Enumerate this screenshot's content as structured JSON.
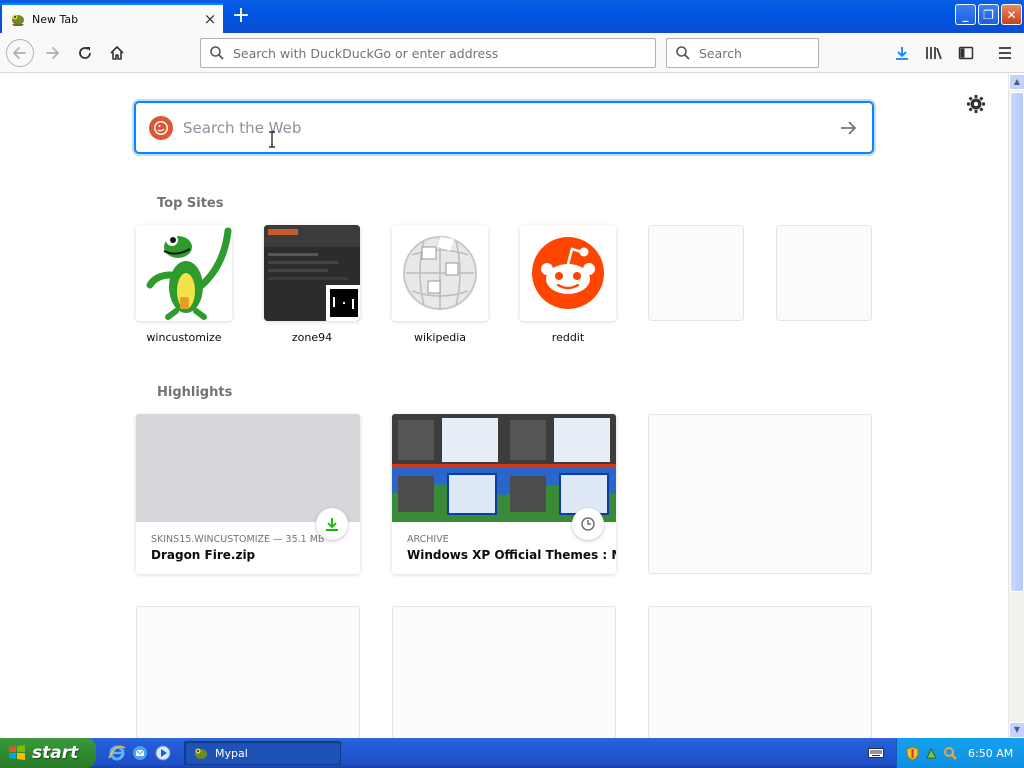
{
  "tab": {
    "title": "New Tab",
    "close_symbol": "×",
    "new_tab_symbol": "+"
  },
  "window_controls": {
    "minimize": "_",
    "restore": "❐",
    "close": "✕"
  },
  "navbar": {
    "url_placeholder": "Search with DuckDuckGo or enter address",
    "search_placeholder": "Search"
  },
  "newtab": {
    "search_placeholder": "Search the Web",
    "top_sites_title": "Top Sites",
    "highlights_title": "Highlights",
    "top_sites": [
      {
        "label": "wincustomize"
      },
      {
        "label": "zone94"
      },
      {
        "label": "wikipedia"
      },
      {
        "label": "reddit"
      },
      {
        "label": ""
      },
      {
        "label": ""
      }
    ],
    "highlights": [
      {
        "meta": "SKINS15.WINCUSTOMIZE — 35.1 MB",
        "title": "Dragon Fire.zip",
        "badge": "download-icon"
      },
      {
        "meta": "ARCHIVE",
        "title": "Windows XP Official Themes : M...",
        "badge": "clock-icon"
      }
    ]
  },
  "taskbar": {
    "start_label": "start",
    "task_label": "Mypal",
    "clock": "6:50 AM"
  },
  "colors": {
    "accent": "#0a84ff",
    "ddg": "#de5833",
    "reddit": "#ff4500",
    "xp_blue": "#0054e3",
    "start_green": "#2f8b2f"
  }
}
